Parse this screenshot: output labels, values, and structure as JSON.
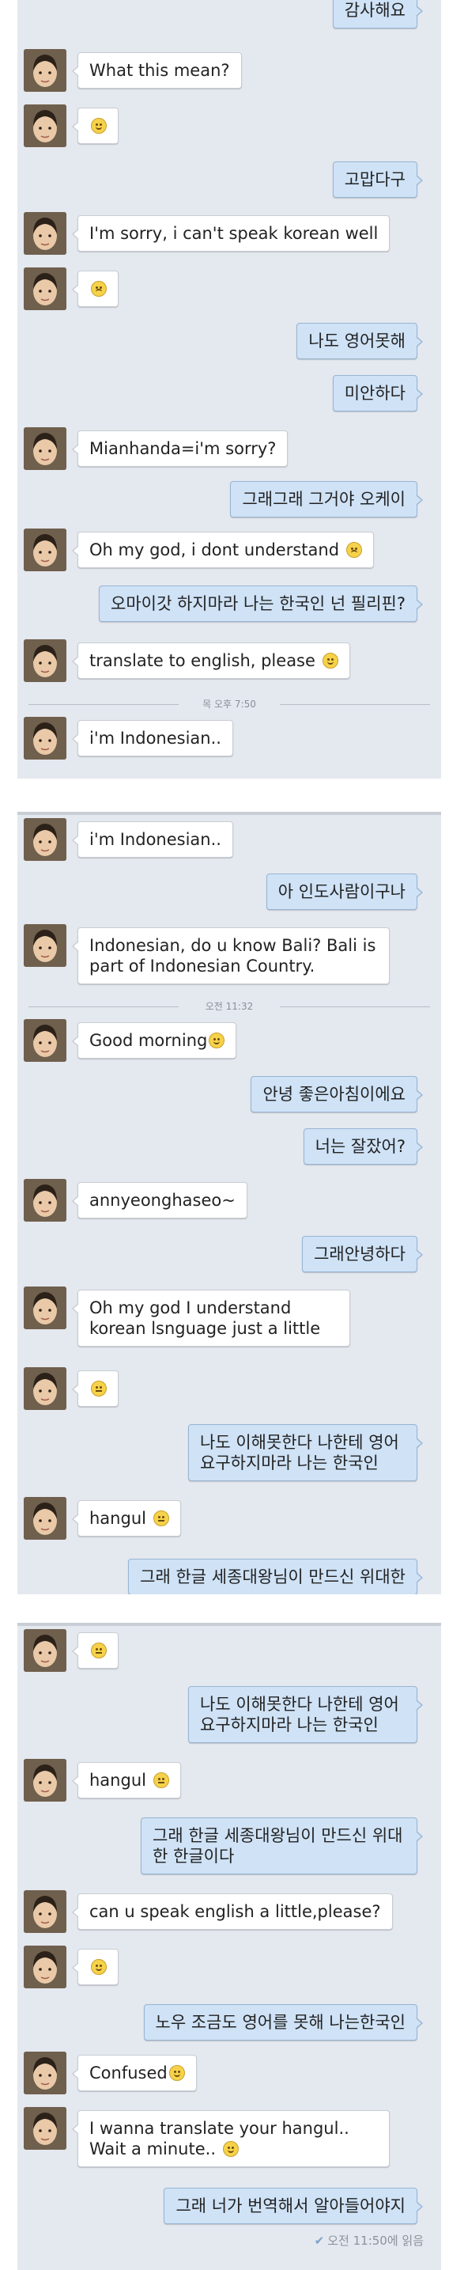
{
  "panel1": {
    "msgs": [
      {
        "text": "감사해요"
      },
      {
        "text": "What this mean?"
      },
      {
        "text": ""
      },
      {
        "text": "고맙다구"
      },
      {
        "text": "I'm sorry, i can't speak korean well"
      },
      {
        "text": ""
      },
      {
        "text": "나도 영어못해"
      },
      {
        "text": "미안하다"
      },
      {
        "text": "Mianhanda=i'm sorry?"
      },
      {
        "text": "그래그래 그거야 오케이"
      },
      {
        "text": "Oh my god, i dont understand"
      },
      {
        "text": "오마이갓 하지마라 나는 한국인 넌 필리핀?"
      },
      {
        "text": "translate to english, please"
      },
      {
        "text": "i'm Indonesian.."
      }
    ],
    "divider": "목 오후 7:50"
  },
  "panel2": {
    "msgs": [
      {
        "text": "i'm Indonesian.."
      },
      {
        "text": "아 인도사람이구나"
      },
      {
        "text": "Indonesian, do u know Bali? Bali is part of Indonesian Country."
      },
      {
        "text": "Good morning"
      },
      {
        "text": "안녕 좋은아침이에요"
      },
      {
        "text": "너는 잘잤어?"
      },
      {
        "text": "annyeonghaseo~"
      },
      {
        "text": "그래안녕하다"
      },
      {
        "text": "Oh my god I understand korean lsnguage just a little"
      },
      {
        "text": ""
      },
      {
        "text": "나도 이해못한다 나한테 영어 요구하지마라 나는 한국인"
      },
      {
        "text": "hangul"
      },
      {
        "text": "그래 한글 세종대왕님이 만드신 위대한"
      }
    ],
    "divider": "오전 11:32"
  },
  "panel3": {
    "msgs": [
      {
        "text": ""
      },
      {
        "text": "나도 이해못한다 나한테 영어 요구하지마라 나는 한국인"
      },
      {
        "text": "hangul"
      },
      {
        "text": "그래 한글 세종대왕님이 만드신 위대한 한글이다"
      },
      {
        "text": "can u speak english a little,please?"
      },
      {
        "text": ""
      },
      {
        "text": "노우 조금도 영어를 못해 나는한국인"
      },
      {
        "text": "Confused"
      },
      {
        "text": "I wanna translate your hangul.. Wait a minute.."
      },
      {
        "text": "그래 너가 번역해서 알아들어야지"
      }
    ],
    "receipt": "오전 11:50에 읽음"
  },
  "colors": {
    "chat_bg": "#e4e8ef",
    "incoming": "#ffffff",
    "outgoing": "#cfe2f6"
  }
}
